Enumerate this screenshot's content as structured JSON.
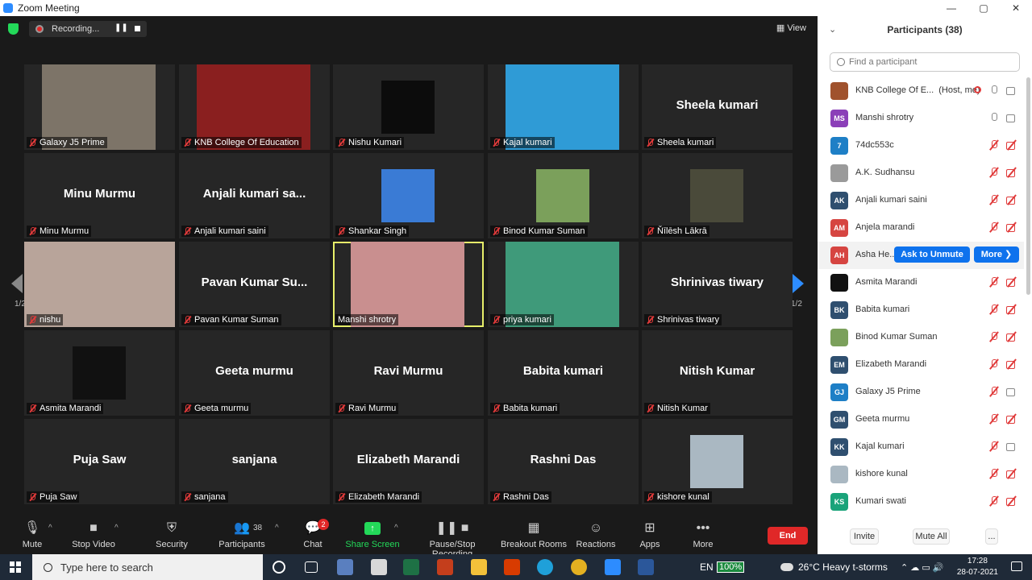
{
  "window": {
    "title": "Zoom Meeting",
    "controls": [
      "—",
      "▢",
      "✕"
    ]
  },
  "top_bar": {
    "recording_label": "Recording...",
    "pause_icon": "pause-icon",
    "stop_icon": "stop-icon",
    "view_label": "View"
  },
  "pagination": {
    "left": "1/2",
    "right": "1/2"
  },
  "tiles": [
    {
      "label": "Galaxy J5 Prime",
      "big": "",
      "video": "photo",
      "color": "#7d7468"
    },
    {
      "label": "KNB College Of Education",
      "big": "",
      "video": "photo",
      "color": "#8a1f1f"
    },
    {
      "label": "Nishu Kumari",
      "big": "",
      "video": "square",
      "color": "#0c0c0c"
    },
    {
      "label": "Kajal kumari",
      "big": "",
      "video": "photo",
      "color": "#2f9bd6"
    },
    {
      "label": "Sheela kumari",
      "big": "Sheela kumari",
      "video": "none",
      "color": ""
    },
    {
      "label": "Minu Murmu",
      "big": "Minu Murmu",
      "video": "none",
      "color": ""
    },
    {
      "label": "Anjali kumari saini",
      "big": "Anjali kumari sa...",
      "video": "none",
      "color": ""
    },
    {
      "label": "Shankar Singh",
      "big": "",
      "video": "square",
      "color": "#3a7bd5"
    },
    {
      "label": "Binod Kumar Suman",
      "big": "",
      "video": "square",
      "color": "#7ba05b"
    },
    {
      "label": "Ňīlēsh Lākrā",
      "big": "",
      "video": "square",
      "color": "#4a4a3a"
    },
    {
      "label": "nishu",
      "big": "",
      "video": "wide",
      "color": "#b8a49a"
    },
    {
      "label": "Pavan Kumar Suman",
      "big": "Pavan Kumar Su...",
      "video": "none",
      "color": ""
    },
    {
      "label": "Manshi shrotry",
      "big": "",
      "video": "photo",
      "color": "#c98f8f",
      "active": true
    },
    {
      "label": "priya kumari",
      "big": "",
      "video": "photo",
      "color": "#3f9a7a"
    },
    {
      "label": "Shrinivas tiwary",
      "big": "Shrinivas tiwary",
      "video": "none",
      "color": ""
    },
    {
      "label": "Asmita Marandi",
      "big": "",
      "video": "square",
      "color": "#111111"
    },
    {
      "label": "Geeta murmu",
      "big": "Geeta murmu",
      "video": "none",
      "color": ""
    },
    {
      "label": "Ravi Murmu",
      "big": "Ravi Murmu",
      "video": "none",
      "color": ""
    },
    {
      "label": "Babita kumari",
      "big": "Babita kumari",
      "video": "none",
      "color": ""
    },
    {
      "label": "Nitish Kumar",
      "big": "Nitish Kumar",
      "video": "none",
      "color": ""
    },
    {
      "label": "Puja Saw",
      "big": "Puja Saw",
      "video": "none",
      "color": ""
    },
    {
      "label": "sanjana",
      "big": "sanjana",
      "video": "none",
      "color": ""
    },
    {
      "label": "Elizabeth Marandi",
      "big": "Elizabeth Marandi",
      "video": "none",
      "color": ""
    },
    {
      "label": "Rashni Das",
      "big": "Rashni Das",
      "video": "none",
      "color": ""
    },
    {
      "label": "kishore kunal",
      "big": "",
      "video": "square",
      "color": "#aab8c2"
    }
  ],
  "toolbar": {
    "mute": "Mute",
    "stop_video": "Stop Video",
    "security": "Security",
    "participants": "Participants",
    "participants_count": "38",
    "chat": "Chat",
    "chat_badge": "2",
    "share_screen": "Share Screen",
    "recording": "Pause/Stop Recording",
    "breakout": "Breakout Rooms",
    "reactions": "Reactions",
    "apps": "Apps",
    "more": "More",
    "end": "End"
  },
  "panel": {
    "title": "Participants (38)",
    "search_placeholder": "Find a participant",
    "ask_unmute": "Ask to Unmute",
    "more_btn": "More ❯",
    "invite": "Invite",
    "mute_all": "Mute All",
    "ellipsis": "...",
    "participants": [
      {
        "name": "KNB College Of E...",
        "tag": "(Host, me)",
        "initials": "",
        "color": "#a0522d",
        "mic": "on",
        "cam": "on",
        "rec": true
      },
      {
        "name": "Manshi shrotry",
        "tag": "",
        "initials": "MS",
        "color": "#8b3fb8",
        "mic": "on",
        "cam": "on"
      },
      {
        "name": "74dc553c",
        "tag": "",
        "initials": "7",
        "color": "#1e7fc6",
        "mic": "off",
        "cam": "off"
      },
      {
        "name": "A.K. Sudhansu",
        "tag": "",
        "initials": "",
        "color": "#9a9a9a",
        "mic": "off",
        "cam": "off"
      },
      {
        "name": "Anjali kumari saini",
        "tag": "",
        "initials": "AK",
        "color": "#2f4f6f",
        "mic": "off",
        "cam": "off"
      },
      {
        "name": "Anjela marandi",
        "tag": "",
        "initials": "AM",
        "color": "#d64541",
        "mic": "off",
        "cam": "off"
      },
      {
        "name": "Asha He...",
        "tag": "",
        "initials": "AH",
        "color": "#d64541",
        "mic": "off",
        "cam": "off",
        "hover": true
      },
      {
        "name": "Asmita Marandi",
        "tag": "",
        "initials": "",
        "color": "#111111",
        "mic": "off",
        "cam": "off"
      },
      {
        "name": "Babita kumari",
        "tag": "",
        "initials": "BK",
        "color": "#2f4f6f",
        "mic": "off",
        "cam": "off"
      },
      {
        "name": "Binod Kumar Suman",
        "tag": "",
        "initials": "",
        "color": "#7ba05b",
        "mic": "off",
        "cam": "off"
      },
      {
        "name": "Elizabeth Marandi",
        "tag": "",
        "initials": "EM",
        "color": "#2f4f6f",
        "mic": "off",
        "cam": "off"
      },
      {
        "name": "Galaxy J5 Prime",
        "tag": "",
        "initials": "GJ",
        "color": "#1e7fc6",
        "mic": "off",
        "cam": "on"
      },
      {
        "name": "Geeta murmu",
        "tag": "",
        "initials": "GM",
        "color": "#2f4f6f",
        "mic": "off",
        "cam": "off"
      },
      {
        "name": "Kajal kumari",
        "tag": "",
        "initials": "KK",
        "color": "#2f4f6f",
        "mic": "off",
        "cam": "on"
      },
      {
        "name": "kishore kunal",
        "tag": "",
        "initials": "",
        "color": "#aab8c2",
        "mic": "off",
        "cam": "off"
      },
      {
        "name": "Kumari swati",
        "tag": "",
        "initials": "KS",
        "color": "#1aa37a",
        "mic": "off",
        "cam": "off"
      }
    ]
  },
  "taskbar": {
    "search_placeholder": "Type here to search",
    "lang": "EN",
    "battery": "100%",
    "weather": "26°C  Heavy t-storms",
    "time": "17:28",
    "date": "28-07-2021"
  }
}
